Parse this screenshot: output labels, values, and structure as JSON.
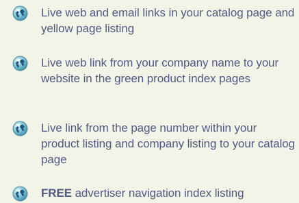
{
  "items": [
    {
      "icon": "globe-bullet-icon",
      "text": "Live web and email links in your catalog page and yellow page listing"
    },
    {
      "icon": "globe-bullet-icon",
      "text": "Live web link from your company name to your website in the green product index pages"
    },
    {
      "icon": "globe-bullet-icon",
      "text": "Live link from the page number within your product listing and company listing to your catalog page"
    },
    {
      "icon": "globe-bullet-icon",
      "bold_text": "FREE",
      "text": "advertiser navigation index listing"
    }
  ]
}
